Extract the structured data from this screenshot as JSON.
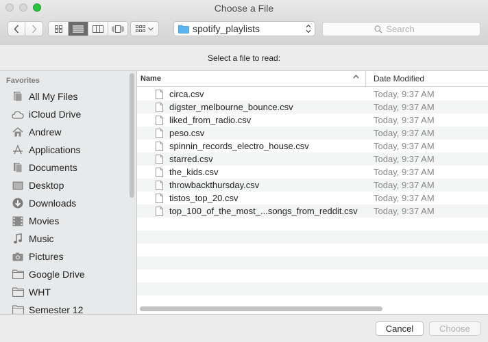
{
  "window": {
    "title": "Choose a File",
    "prompt": "Select a file to read:"
  },
  "toolbar": {
    "back_icon": "chevron-left-icon",
    "forward_icon": "chevron-right-icon",
    "view_modes": [
      "icon-view",
      "list-view",
      "column-view",
      "cover-flow-view"
    ],
    "active_view": "list-view",
    "arrange_icon": "arrange-grid-icon",
    "location": "spotify_playlists",
    "search_placeholder": "Search"
  },
  "sidebar": {
    "heading": "Favorites",
    "items": [
      {
        "label": "All My Files",
        "icon": "all-files-icon"
      },
      {
        "label": "iCloud Drive",
        "icon": "cloud-icon"
      },
      {
        "label": "Andrew",
        "icon": "home-icon"
      },
      {
        "label": "Applications",
        "icon": "applications-icon"
      },
      {
        "label": "Documents",
        "icon": "documents-icon"
      },
      {
        "label": "Desktop",
        "icon": "desktop-icon"
      },
      {
        "label": "Downloads",
        "icon": "downloads-icon"
      },
      {
        "label": "Movies",
        "icon": "movies-icon"
      },
      {
        "label": "Music",
        "icon": "music-icon"
      },
      {
        "label": "Pictures",
        "icon": "pictures-icon"
      },
      {
        "label": "Google Drive",
        "icon": "folder-icon"
      },
      {
        "label": "WHT",
        "icon": "folder-icon"
      },
      {
        "label": "Semester 12",
        "icon": "folder-icon"
      }
    ]
  },
  "filelist": {
    "columns": {
      "name": "Name",
      "date": "Date Modified"
    },
    "files": [
      {
        "name": "circa.csv",
        "date": "Today, 9:37 AM"
      },
      {
        "name": "digster_melbourne_bounce.csv",
        "date": "Today, 9:37 AM"
      },
      {
        "name": "liked_from_radio.csv",
        "date": "Today, 9:37 AM"
      },
      {
        "name": "peso.csv",
        "date": "Today, 9:37 AM"
      },
      {
        "name": "spinnin_records_electro_house.csv",
        "date": "Today, 9:37 AM"
      },
      {
        "name": "starred.csv",
        "date": "Today, 9:37 AM"
      },
      {
        "name": "the_kids.csv",
        "date": "Today, 9:37 AM"
      },
      {
        "name": "throwbackthursday.csv",
        "date": "Today, 9:37 AM"
      },
      {
        "name": "tistos_top_20.csv",
        "date": "Today, 9:37 AM"
      },
      {
        "name": "top_100_of_the_most_...songs_from_reddit.csv",
        "date": "Today, 9:37 AM"
      }
    ]
  },
  "footer": {
    "cancel_label": "Cancel",
    "choose_label": "Choose"
  },
  "colors": {
    "zoom_button": "#29c33f",
    "folder": "#5bb3f0",
    "active_segment": "#6b6b6b"
  }
}
